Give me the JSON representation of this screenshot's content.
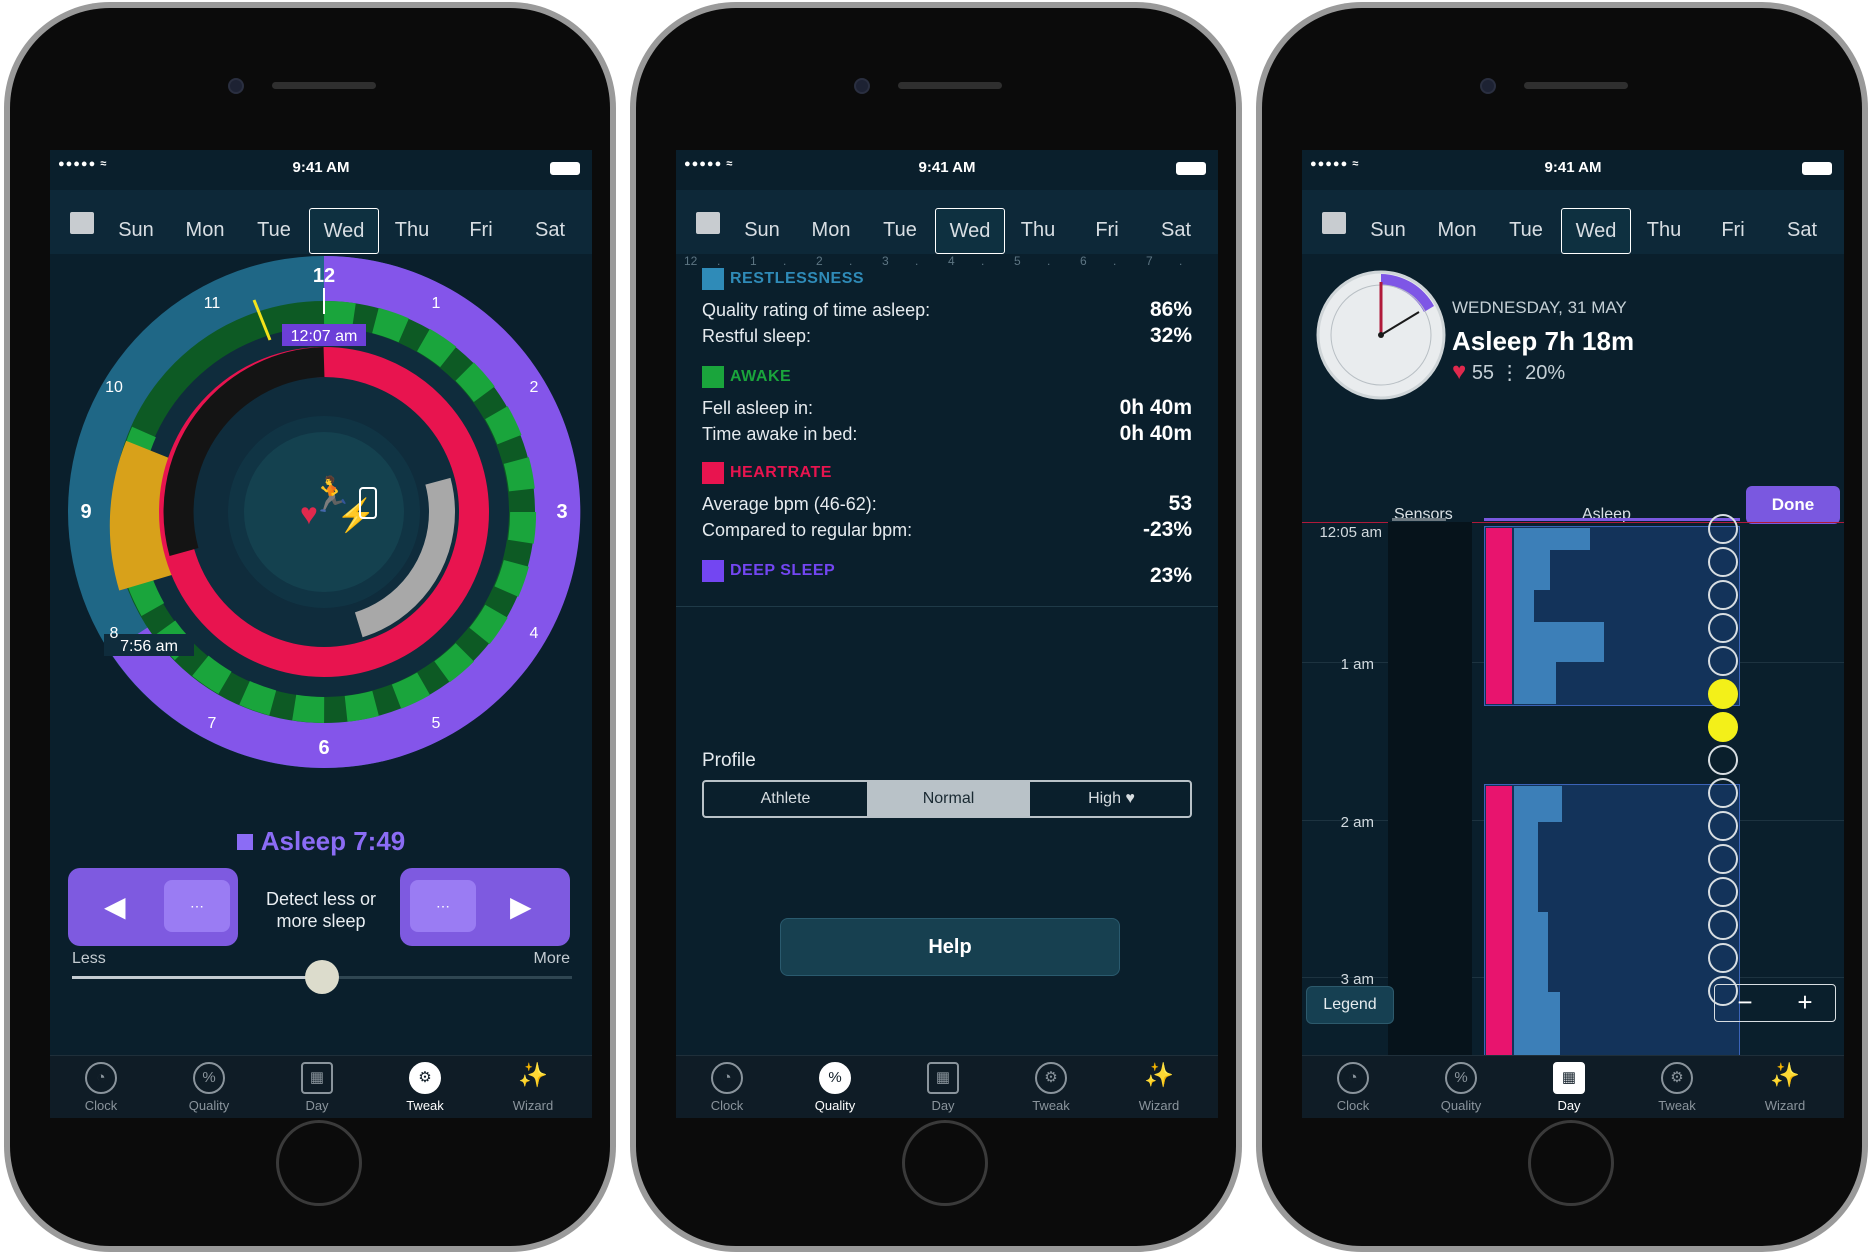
{
  "status": {
    "time": "9:41 AM",
    "signal": "●●●●● ≈"
  },
  "days": [
    "Sun",
    "Mon",
    "Tue",
    "Wed",
    "Thu",
    "Fri",
    "Sat"
  ],
  "selected_day": "Wed",
  "tabs": [
    "Clock",
    "Quality",
    "Day",
    "Tweak",
    "Wizard"
  ],
  "colors": {
    "accent": "#8b6cf5",
    "heartrate": "#e8144f",
    "awake": "#16a33a",
    "restless": "#2f8bb8",
    "deep": "#7346f2"
  },
  "tweak": {
    "dial_numbers": [
      "12",
      "1",
      "2",
      "3",
      "4",
      "5",
      "6",
      "7",
      "8",
      "9",
      "10",
      "11"
    ],
    "start_time": "12:07 am",
    "end_time": "7:56 am",
    "asleep_label": "Asleep 7:49",
    "detect_label": "Detect less or more sleep",
    "less_label": "Less",
    "more_label": "More",
    "slider_value": 0.5,
    "left_inner": "⋯",
    "right_inner": "⋯",
    "active_tab": "Tweak"
  },
  "quality": {
    "ruler": [
      "12",
      ".",
      "1",
      ".",
      "2",
      ".",
      "3",
      ".",
      "4",
      ".",
      "5",
      ".",
      "6",
      ".",
      "7",
      "."
    ],
    "restlessness": {
      "title": "RESTLESSNESS",
      "rows": [
        {
          "label": "Quality rating of time asleep:",
          "value": "86%"
        },
        {
          "label": "Restful sleep:",
          "value": "32%"
        }
      ]
    },
    "awake": {
      "title": "AWAKE",
      "rows": [
        {
          "label": "Fell asleep in:",
          "value": "0h 40m"
        },
        {
          "label": "Time awake in bed:",
          "value": "0h 40m"
        }
      ]
    },
    "heartrate": {
      "title": "HEARTRATE",
      "rows": [
        {
          "label": "Average bpm (46-62):",
          "value": "53"
        },
        {
          "label": "Compared to regular bpm:",
          "value": "-23%"
        }
      ]
    },
    "deep": {
      "title": "DEEP SLEEP",
      "value": "23%"
    },
    "profile_label": "Profile",
    "profile_options": [
      "Athlete",
      "Normal",
      "High ♥"
    ],
    "profile_selected": "Normal",
    "help_label": "Help",
    "active_tab": "Quality"
  },
  "day": {
    "date": "WEDNESDAY, 31 MAY",
    "asleep": "Asleep 7h 18m",
    "heart_bpm": "55",
    "movement": "⋮ 20%",
    "tabs": [
      "Sensors",
      "Asleep"
    ],
    "done_label": "Done",
    "times": [
      "12:05 am",
      "1 am",
      "2 am",
      "3 am"
    ],
    "legend_label": "Legend",
    "zoom_minus": "−",
    "zoom_plus": "+",
    "snore_markers": [
      false,
      false,
      false,
      false,
      false,
      true,
      true,
      false,
      false,
      false,
      false,
      false,
      false,
      false,
      false
    ],
    "active_tab": "Day"
  }
}
